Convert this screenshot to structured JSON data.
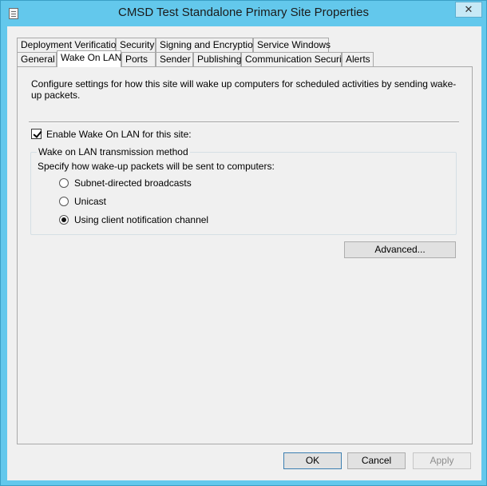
{
  "window": {
    "title": "CMSD Test Standalone Primary Site Properties",
    "close_label": "✕"
  },
  "tabs_back": [
    {
      "label": "Deployment Verification"
    },
    {
      "label": "Security"
    },
    {
      "label": "Signing and Encryption"
    },
    {
      "label": "Service Windows"
    }
  ],
  "tabs_front": [
    {
      "label": "General"
    },
    {
      "label": "Wake On LAN"
    },
    {
      "label": "Ports"
    },
    {
      "label": "Sender"
    },
    {
      "label": "Publishing"
    },
    {
      "label": "Communication Security"
    },
    {
      "label": "Alerts"
    }
  ],
  "active_tab": "Wake On LAN",
  "panel": {
    "description": "Configure settings for how this site will wake up computers for scheduled activities by sending wake-up packets.",
    "enable_label": "Enable Wake On LAN for this site:",
    "enable_checked": true,
    "group_title": "Wake on LAN transmission method",
    "group_desc": "Specify how wake-up packets will be sent to computers:",
    "options": [
      {
        "label": "Subnet-directed broadcasts",
        "selected": false
      },
      {
        "label": "Unicast",
        "selected": false
      },
      {
        "label": "Using client notification channel",
        "selected": true
      }
    ],
    "advanced_label": "Advanced..."
  },
  "footer": {
    "ok_label": "OK",
    "cancel_label": "Cancel",
    "apply_label": "Apply",
    "apply_enabled": false
  }
}
